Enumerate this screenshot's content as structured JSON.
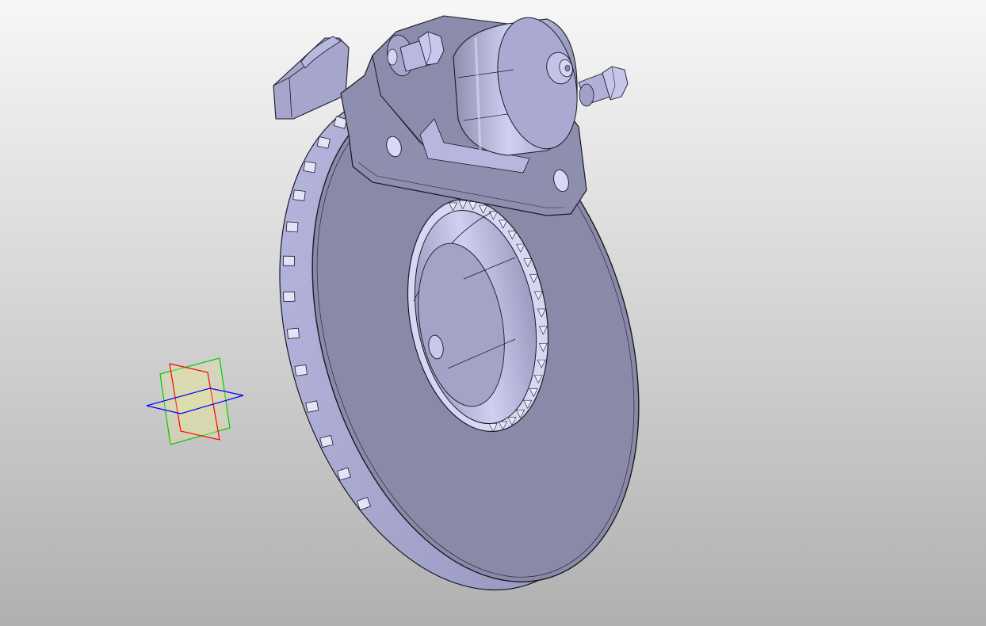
{
  "viewport": {
    "background_top": "#f7f7f7",
    "background_bottom": "#b0b0b0"
  },
  "model": {
    "body_color": "#8a8aa8",
    "face_color": "#9d9dc0",
    "highlight_color": "#c8c8ee",
    "edge_color": "#1a1a24"
  },
  "reference_planes": {
    "xy_plane_color": "#0000ff",
    "yz_plane_color": "#ff0000",
    "xz_plane_color": "#00cc00",
    "fill_color": "#e6e6a0"
  },
  "icons": [
    "brake-disc-model-icon",
    "brake-caliper-model-icon",
    "origin-reference-planes-icon"
  ]
}
